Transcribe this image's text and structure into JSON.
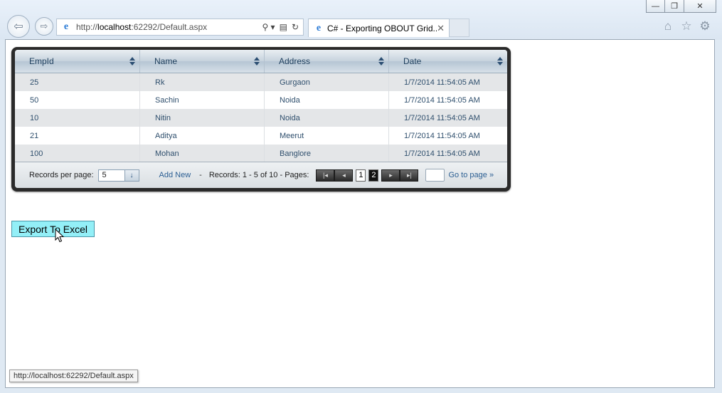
{
  "window": {
    "minimize": "—",
    "maximize": "❐",
    "close": "✕"
  },
  "browser": {
    "url_prefix": "http://",
    "url_host": "localhost",
    "url_rest": ":62292/Default.aspx",
    "tab_title": "C# - Exporting OBOUT Grid...",
    "tab_close": "✕",
    "search_glyph": "⚲ ▾",
    "compat_glyph": "▤",
    "refresh_glyph": "↻"
  },
  "grid": {
    "columns": [
      "EmpId",
      "Name",
      "Address",
      "Date"
    ],
    "rows": [
      [
        "25",
        "Rk",
        "Gurgaon",
        "1/7/2014 11:54:05 AM"
      ],
      [
        "50",
        "Sachin",
        "Noida",
        "1/7/2014 11:54:05 AM"
      ],
      [
        "10",
        "Nitin",
        "Noida",
        "1/7/2014 11:54:05 AM"
      ],
      [
        "21",
        "Aditya",
        "Meerut",
        "1/7/2014 11:54:05 AM"
      ],
      [
        "100",
        "Mohan",
        "Banglore",
        "1/7/2014 11:54:05 AM"
      ]
    ],
    "footer": {
      "records_per_page_label": "Records per page:",
      "records_per_page_value": "5",
      "add_new": "Add New",
      "separator": "-",
      "records_info": "Records: 1 - 5 of 10 - Pages:",
      "page_current": "1",
      "page_other": "2",
      "go_to_page": "Go to page »"
    }
  },
  "export_button": "Export To Excel",
  "status_bar": "http://localhost:62292/Default.aspx"
}
